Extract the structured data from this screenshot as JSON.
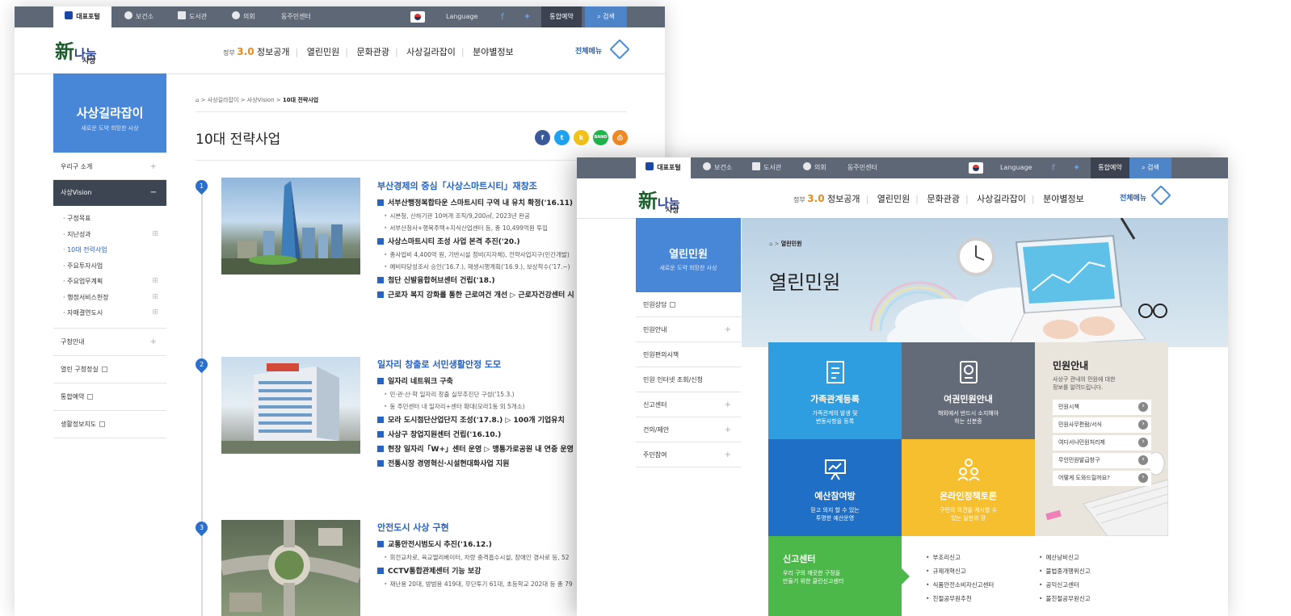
{
  "utility_bar": {
    "portal": "대표포털",
    "health": "보건소",
    "library": "도서관",
    "council": "의회",
    "community": "동주민센터",
    "language": "Language",
    "reservation": "통합예약",
    "search": "검색"
  },
  "header": {
    "logo_main": "新",
    "logo_text": "나눔",
    "logo_sub": "사상",
    "gov_label": "정부",
    "gov_num": "3.0",
    "nav": [
      "정보공개",
      "열린민원",
      "문화관광",
      "사상길라잡이",
      "분야별정보"
    ],
    "all_menu": "전체메뉴"
  },
  "win1": {
    "lnb_title": "사상길라잡이",
    "lnb_subtitle": "새로운 도약 희망찬 사상",
    "lnb_items": [
      "우리구 소개",
      "사상Vision"
    ],
    "lnb_sub": [
      "구정목표",
      "지난성과",
      "10대 전략사업",
      "주요투자사업",
      "주요업무계획",
      "행정서비스헌장",
      "자매결연도시"
    ],
    "lnb_items2": [
      "구청안내",
      "열린 구청정실",
      "통합예약",
      "생활정보지도"
    ],
    "breadcrumb": [
      "사상길라잡이",
      "사상Vision",
      "10대 전략사업"
    ],
    "page_title": "10대 전략사업",
    "share": {
      "band": "BAND"
    },
    "sections": [
      {
        "num": "1",
        "title": "부산경제의 중심「사상스마트시티」재창조",
        "lines": [
          {
            "t": "b",
            "text": "서부산행정복합타운 스마트시티 구역 내 유치 확정('16.11)"
          },
          {
            "t": "d",
            "text": "시본청, 산하기관 10여개 조직/9,200㎡, 2023년 완공"
          },
          {
            "t": "d",
            "text": "서부산청사+행복주택+지식산업센터 등, 총 10,499억원 투입"
          },
          {
            "t": "b",
            "text": "사상스마트시티 조성 사업 본격 추진('20.)"
          },
          {
            "t": "d",
            "text": "총사업비 4,400억 원, 기반시설 정비(지자체), 전략사업지구(민간개발)"
          },
          {
            "t": "d",
            "text": "예비타당성조사 승인('16.7.), 재생시행계획('16.9.), 보상착수('17.~)"
          },
          {
            "t": "b",
            "text": "첨단 신발융합허브센터 건립('18.)"
          },
          {
            "t": "b",
            "text": "근로자 복지 강화를 통한 근로여건 개선 ▷ 근로자건강센터 시"
          }
        ]
      },
      {
        "num": "2",
        "title": "일자리 창출로 서민생활안정 도모",
        "lines": [
          {
            "t": "b",
            "text": "일자리 네트워크 구축"
          },
          {
            "t": "d",
            "text": "민·관·산·학 일자리 창출 실무추진단 구성('15.3.)"
          },
          {
            "t": "d",
            "text": "동 주민센터 내 일자리+센터 확대(모라1동 외 5개소)"
          },
          {
            "t": "b",
            "text": "모라 도시첨단산업단지 조성('17.8.) ▷ 100개 기업유치"
          },
          {
            "t": "b",
            "text": "사상구 창업지원센터 건립('16.10.)"
          },
          {
            "t": "b",
            "text": "현장 일자리「W+」센터 운영 ▷ 맹통가로공원 내 연중 운영"
          },
          {
            "t": "b",
            "text": "전통시장 경영혁신·시설현대화사업 지원"
          }
        ]
      },
      {
        "num": "3",
        "title": "안전도시 사상 구현",
        "lines": [
          {
            "t": "b",
            "text": "교통안전시범도시 추진('16.12.)"
          },
          {
            "t": "d",
            "text": "회전교차로, 육교엘리베이터, 차량 충격흡수시설, 장애인 경사로 등, 52"
          },
          {
            "t": "b",
            "text": "CCTV통합관제센터 기능 보강"
          },
          {
            "t": "d",
            "text": "재난용 20대, 방범용 419대, 무단투기 61대, 초등학교 202대 등 총 79"
          }
        ]
      }
    ]
  },
  "win2": {
    "lnb_title": "열린민원",
    "lnb_subtitle": "새로운 도약 희망찬 사상",
    "lnb_items": [
      "민원상담",
      "민원안내",
      "민원편의시책",
      "민원 인터넷 조회/신청",
      "신고센터",
      "건의/제안",
      "주민참여"
    ],
    "breadcrumb": "열린민원",
    "page_title": "열린민원",
    "tiles": [
      {
        "title": "가족관계등록",
        "desc1": "가족관계의 발생 및",
        "desc2": "변동사항을 등록",
        "color": "#2e9ee0"
      },
      {
        "title": "여권민원안내",
        "desc1": "해외에서 반드시 소지해야",
        "desc2": "하는 신분증",
        "color": "#636b78"
      },
      {
        "title": "예산참여방",
        "desc1": "믿고 의지 할 수 있는",
        "desc2": "투명한 예산운영",
        "color": "#1f6fc7"
      },
      {
        "title": "온라인정책토론",
        "desc1": "구민의 의견을 게시할 수",
        "desc2": "있는 실현의 장",
        "color": "#f5bf2f"
      }
    ],
    "guide": {
      "title": "민원안내",
      "desc1": "사상구 관내의 민원에 대한",
      "desc2": "정보를 알려드립니다.",
      "links": [
        "민원시책",
        "민원사무편람/서식",
        "여디서나민원처리제",
        "무인민원발급창구",
        "어떻게 도와드릴까요?"
      ]
    },
    "report": {
      "title": "신고센터",
      "desc1": "우리 구의 깨끗한 구정을",
      "desc2": "만들기 위한 클린신고센터",
      "list_left": [
        "부조리신고",
        "규제개혁신고",
        "식품안전소비자신고센터",
        "친절공무원추천"
      ],
      "list_right": [
        "예산낭비신고",
        "불법중개행위신고",
        "공익신고센터",
        "불친절공무원신고"
      ]
    }
  }
}
